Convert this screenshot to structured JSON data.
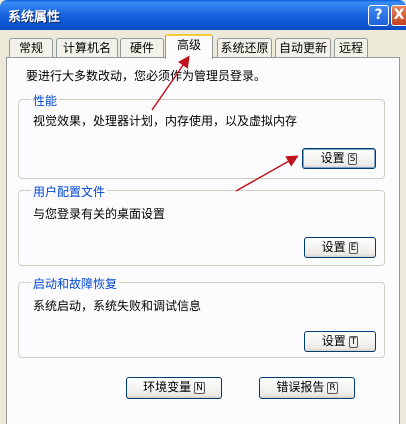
{
  "window": {
    "title": "系统属性",
    "help_icon": "?",
    "close_icon": "X"
  },
  "tabs": [
    {
      "label": "常规",
      "active": false
    },
    {
      "label": "计算机名",
      "active": false
    },
    {
      "label": "硬件",
      "active": false
    },
    {
      "label": "高级",
      "active": true
    },
    {
      "label": "系统还原",
      "active": false
    },
    {
      "label": "自动更新",
      "active": false
    },
    {
      "label": "远程",
      "active": false
    }
  ],
  "admin_hint": "要进行大多数改动，您必须作为管理员登录。",
  "groups": {
    "performance": {
      "title": "性能",
      "description": "视觉效果，处理器计划，内存使用，以及虚拟内存",
      "button_label": "设置",
      "button_accel": "S"
    },
    "user_profiles": {
      "title": "用户配置文件",
      "description": "与您登录有关的桌面设置",
      "button_label": "设置",
      "button_accel": "E"
    },
    "startup_recovery": {
      "title": "启动和故障恢复",
      "description": "系统启动，系统失败和调试信息",
      "button_label": "设置",
      "button_accel": "T"
    }
  },
  "bottom_buttons": {
    "env_vars": {
      "label": "环境变量",
      "accel": "N"
    },
    "error_report": {
      "label": "错误报告",
      "accel": "R"
    }
  },
  "annotation_color": "#c0141e"
}
